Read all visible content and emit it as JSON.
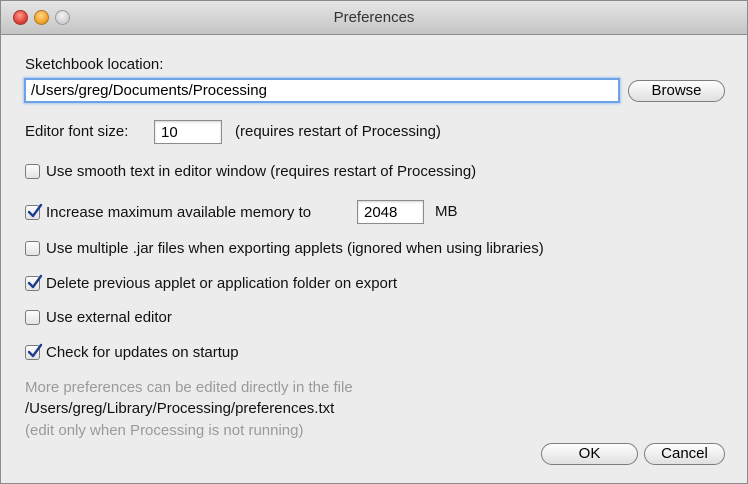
{
  "window": {
    "title": "Preferences",
    "traffic_lights": [
      "close-icon",
      "minimize-icon",
      "zoom-icon"
    ]
  },
  "sketchbook": {
    "label": "Sketchbook location:",
    "value": "/Users/greg/Documents/Processing",
    "browse_label": "Browse"
  },
  "font_size": {
    "label": "Editor font size:",
    "value": "10",
    "note": "(requires restart of Processing)"
  },
  "options": {
    "smooth_text": {
      "label": "Use smooth text in editor window (requires restart of Processing)",
      "checked": false
    },
    "increase_memory": {
      "label": "Increase maximum available memory to",
      "checked": true,
      "value": "2048",
      "unit": "MB"
    },
    "multiple_jar": {
      "label": "Use multiple .jar files when exporting applets (ignored when using libraries)",
      "checked": false
    },
    "delete_previous": {
      "label": "Delete previous applet or application folder on export",
      "checked": true
    },
    "external_editor": {
      "label": "Use external editor",
      "checked": false
    },
    "check_updates": {
      "label": "Check for updates on startup",
      "checked": true
    }
  },
  "footer": {
    "more_prefs": "More preferences can be edited directly in the file",
    "path": "/Users/greg/Library/Processing/preferences.txt",
    "edit_note": "(edit only when Processing is not running)"
  },
  "buttons": {
    "ok": "OK",
    "cancel": "Cancel"
  },
  "colors": {
    "check": "#1b3f8f",
    "focus": "#6ea2e6",
    "hint": "#9a9a9a"
  }
}
